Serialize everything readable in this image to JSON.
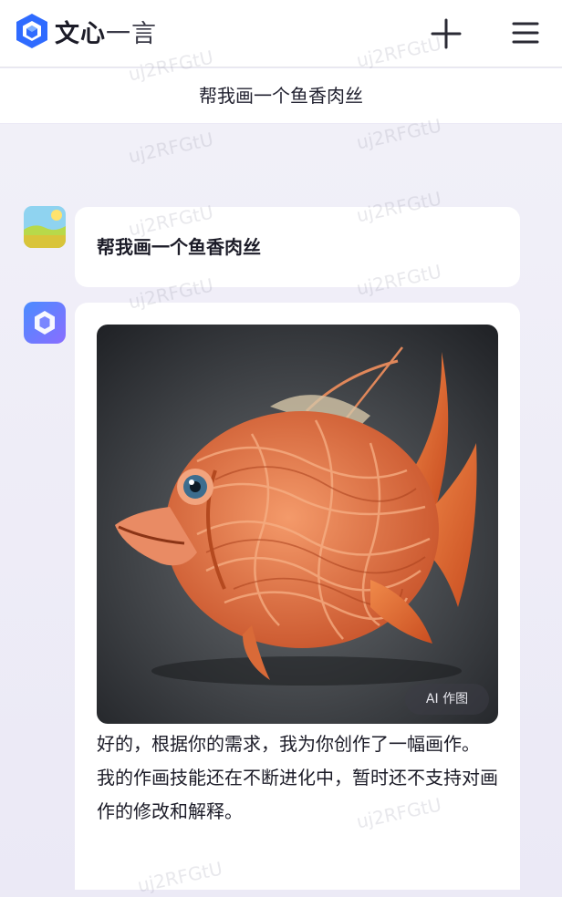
{
  "header": {
    "app_name_bold": "文心",
    "app_name_light": "一言",
    "logo_icon": "wenxin-cube-logo",
    "new_chat_icon": "plus-icon",
    "menu_icon": "hamburger-menu-icon"
  },
  "conversation": {
    "title": "帮我画一个鱼香肉丝"
  },
  "messages": [
    {
      "role": "user",
      "avatar_icon": "user-landscape-avatar",
      "text": "帮我画一个鱼香肉丝"
    },
    {
      "role": "assistant",
      "avatar_icon": "wenxin-bot-avatar",
      "image_badge": "AI 作图",
      "paragraphs": [
        "好的，根据你的需求，我为你创作了一幅画作。",
        "我的作画技能还在不断进化中，暂时还不支持对画作的修改和解释。"
      ]
    }
  ],
  "watermark": "uj2RFGtU",
  "colors": {
    "brand_blue": "#2f6bff",
    "bot_avatar": "#6b7cff",
    "chat_background": "#eceaf6",
    "fish_orange": "#e97a48"
  }
}
